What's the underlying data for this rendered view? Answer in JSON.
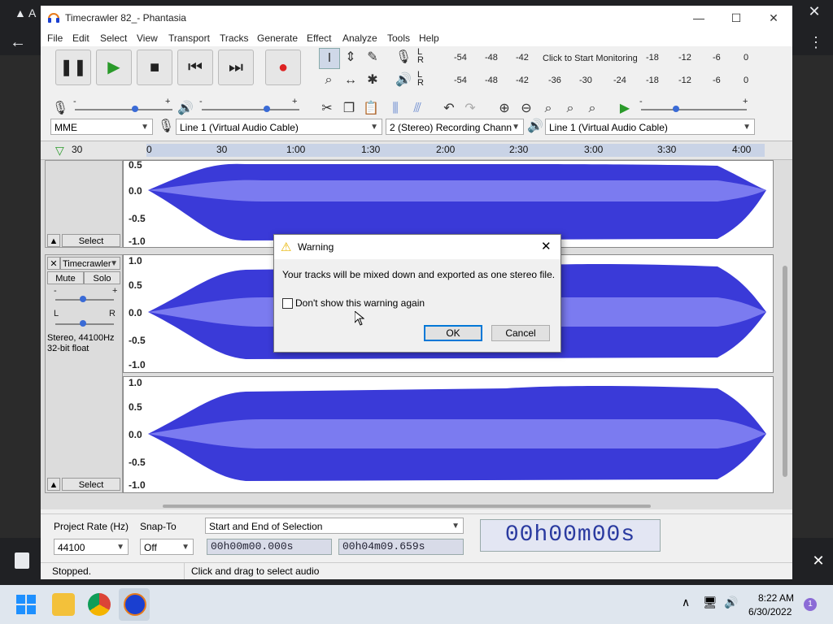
{
  "window": {
    "title": "Timecrawler 82_- Phantasia"
  },
  "menu": [
    "File",
    "Edit",
    "Select",
    "View",
    "Transport",
    "Tracks",
    "Generate",
    "Effect",
    "Analyze",
    "Tools",
    "Help"
  ],
  "meters": {
    "record_scale": [
      "-54",
      "-48",
      "-42",
      "Click to Start Monitoring",
      "-18",
      "-12",
      "-6",
      "0"
    ],
    "play_scale": [
      "-54",
      "-48",
      "-42",
      "-36",
      "-30",
      "-24",
      "-18",
      "-12",
      "-6",
      "0"
    ],
    "lr": [
      "L",
      "R"
    ]
  },
  "devices": {
    "host": "MME",
    "input": "Line 1 (Virtual Audio Cable)",
    "channels": "2 (Stereo) Recording Chann",
    "output": "Line 1 (Virtual Audio Cable)"
  },
  "ruler": {
    "ticks": [
      "30",
      "0",
      "30",
      "1:00",
      "1:30",
      "2:00",
      "2:30",
      "3:00",
      "3:30",
      "4:00"
    ]
  },
  "tracks": {
    "select_label": "Select",
    "track_name": "Timecrawler",
    "mute": "Mute",
    "solo": "Solo",
    "gain_minus": "-",
    "gain_plus": "+",
    "pan_l": "L",
    "pan_r": "R",
    "info_line1": "Stereo, 44100Hz",
    "info_line2": "32-bit float",
    "y_labels_top": [
      "0.5",
      "0.0",
      "-0.5",
      "-1.0"
    ],
    "y_labels_full": [
      "1.0",
      "0.5",
      "0.0",
      "-0.5",
      "-1.0"
    ]
  },
  "selection_bar": {
    "project_rate_label": "Project Rate (Hz)",
    "project_rate": "44100",
    "snap_label": "Snap-To",
    "snap_value": "Off",
    "selection_mode": "Start and End of Selection",
    "start_time": "00h00m00.000s",
    "end_time": "00h04m09.659s",
    "big_time": "00h00m00s"
  },
  "status": {
    "left": "Stopped.",
    "right": "Click and drag to select audio"
  },
  "dialog": {
    "title": "Warning",
    "message": "Your tracks will be mixed down and exported as one stereo file.",
    "checkbox_label": "Don't show this warning again",
    "ok": "OK",
    "cancel": "Cancel"
  },
  "taskbar": {
    "time": "8:22 AM",
    "date": "6/30/2022",
    "notification_count": "1"
  },
  "colors": {
    "waveform": "#3a3ad8",
    "waveform_light": "#7b7bf0",
    "accent": "#0078d7",
    "record": "#d22"
  }
}
